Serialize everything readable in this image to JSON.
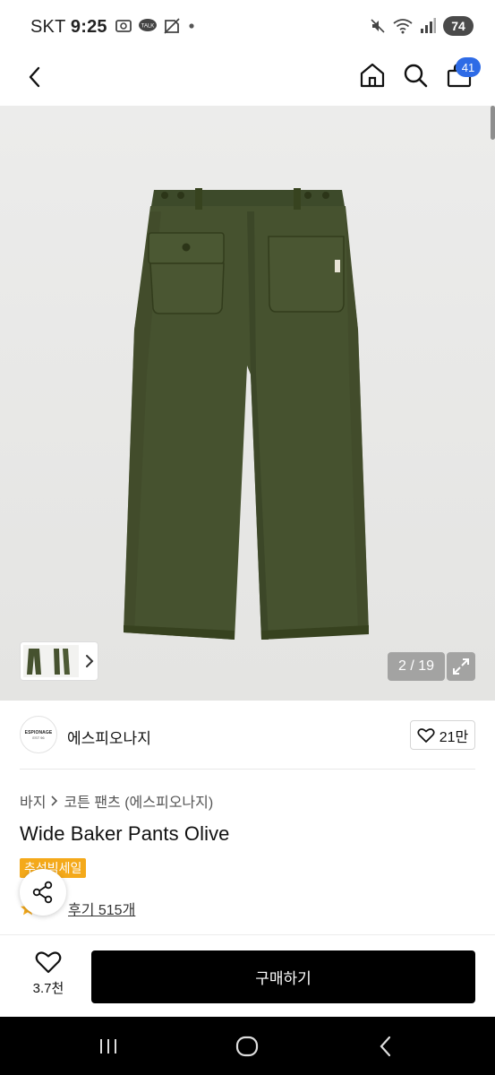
{
  "status_bar": {
    "carrier": "SKT",
    "time": "9:25",
    "battery": "74",
    "icons": [
      "screenshot-icon",
      "kakaotalk-icon",
      "no-sim-icon",
      "mute-icon",
      "wifi-icon",
      "signal-icon",
      "battery-icon"
    ]
  },
  "header": {
    "cart_count": "41",
    "icons": [
      "back-icon",
      "home-icon",
      "search-icon",
      "cart-icon"
    ]
  },
  "gallery": {
    "counter": "2 / 19",
    "current_index": 2,
    "total": 19
  },
  "brand": {
    "logo_line1": "ESPIONAGE",
    "logo_line2": "EST 96",
    "name": "에스피오나지",
    "like_count": "21만"
  },
  "breadcrumb": {
    "items": [
      "바지",
      "코튼 팬츠 (에스피오나지)"
    ]
  },
  "product": {
    "title": "Wide Baker Pants Olive",
    "promo_badge": "추석빅세일",
    "review_link": "후기 515개"
  },
  "purchase_bar": {
    "wish_count": "3.7천",
    "buy_label": "구매하기"
  },
  "colors": {
    "accent_blue": "#2e6be6",
    "promo_orange": "#f4a91a",
    "olive": "#46522f",
    "buy_black": "#000000"
  }
}
